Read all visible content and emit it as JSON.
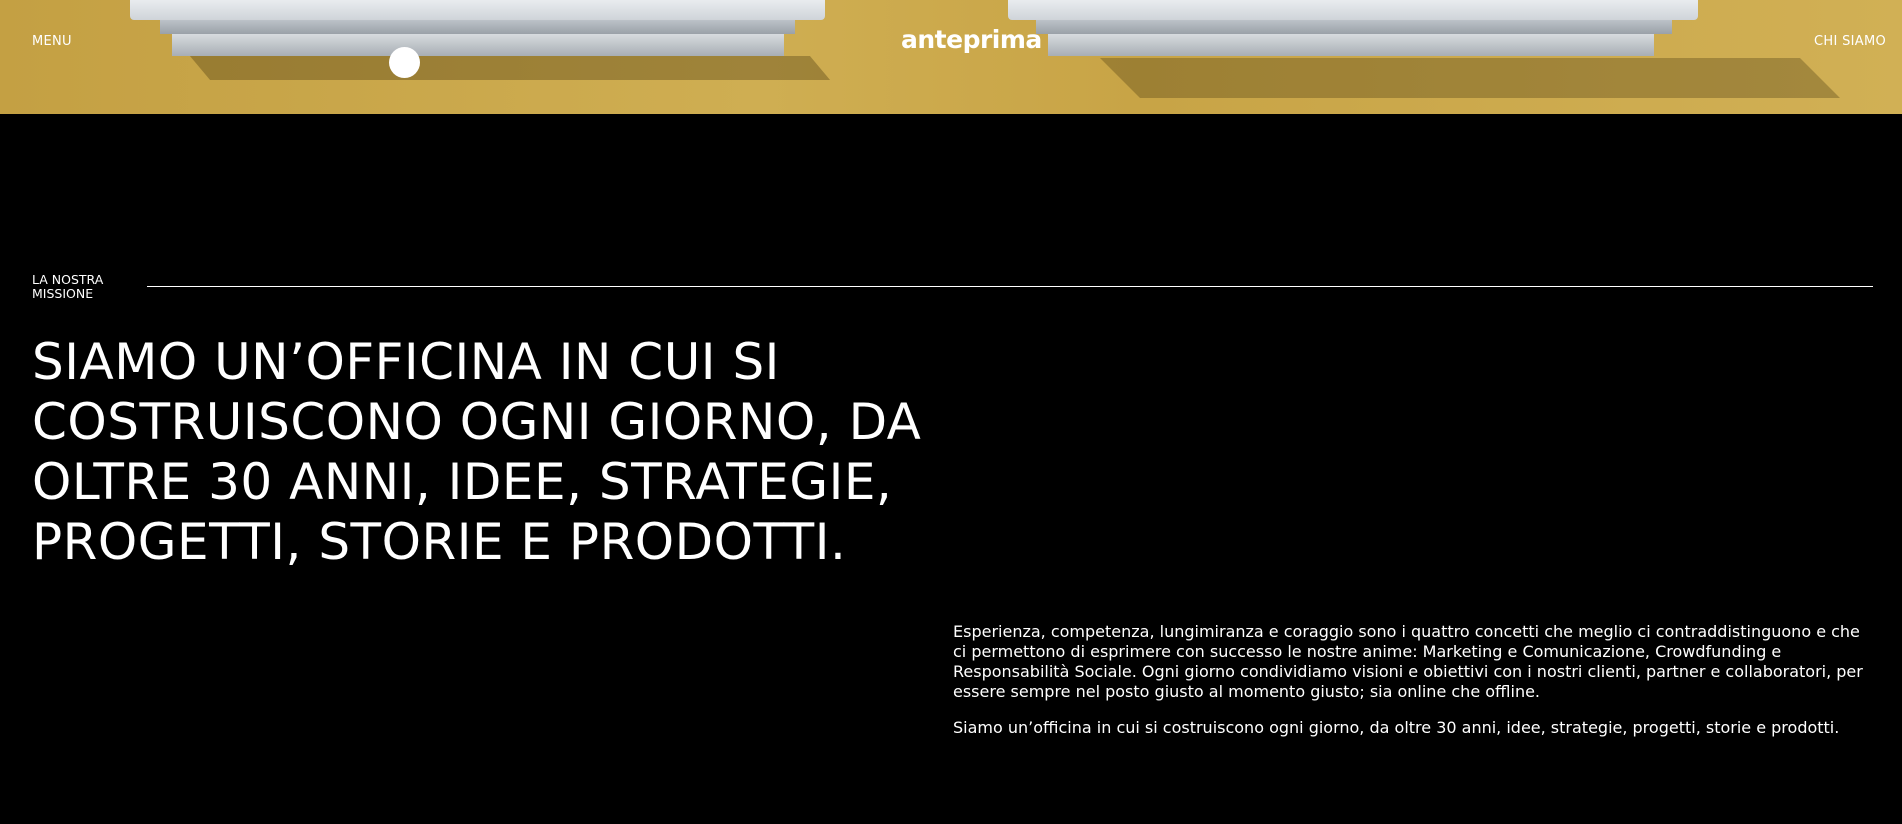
{
  "header": {
    "menu_label": "MENU",
    "logo_text": "anteprima",
    "right_link_label": "CHI SIAMO"
  },
  "hero": {
    "wall_color": "#c9a646"
  },
  "mission": {
    "section_label": "LA NOSTRA MISSIONE",
    "headline": "SIAMO UN’OFFICINA IN CUI SI COSTRUISCONO OGNI GIORNO, DA OLTRE 30 ANNI, IDEE, STRATEGIE, PROGETTI, STORIE E PRODOTTI.",
    "paragraph_1": "Esperienza, competenza, lungimiranza e coraggio sono i quattro concetti che meglio ci contraddistinguono e che ci permettono di esprimere con successo le nostre anime: Marketing e Comunicazione, Crowdfunding e Responsabilità Sociale. Ogni giorno condividiamo visioni e obiettivi con i nostri clienti, partner e collaboratori, per essere sempre nel posto giusto al momento giusto; sia online che offline.",
    "paragraph_2": "Siamo un’officina in cui si costruiscono ogni giorno, da oltre 30 anni, idee, strategie, progetti, storie e prodotti."
  }
}
